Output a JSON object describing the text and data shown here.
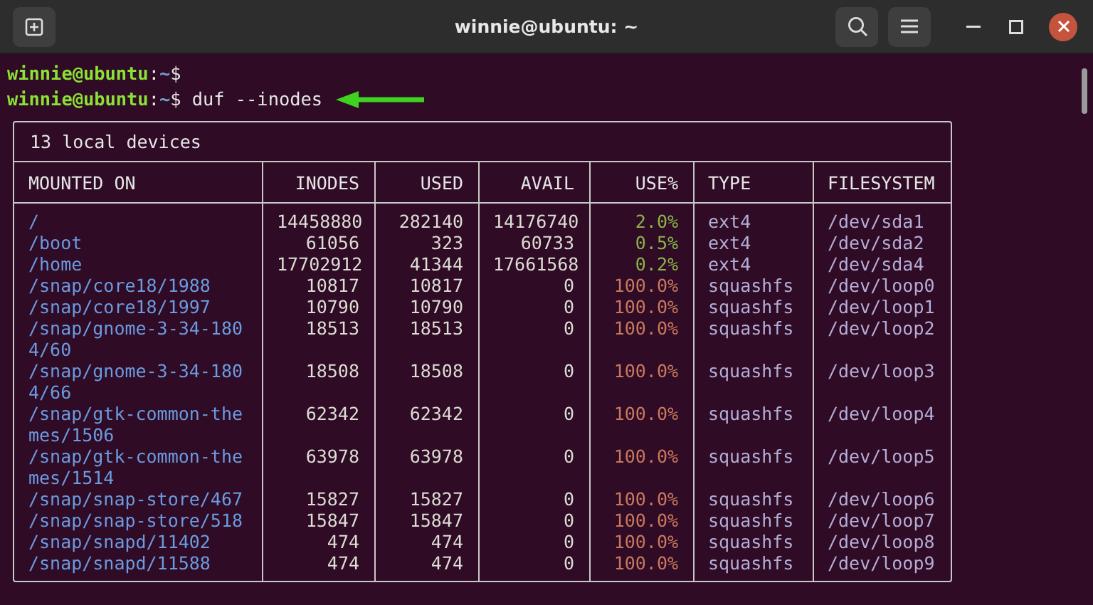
{
  "window": {
    "title": "winnie@ubuntu: ~"
  },
  "terminal_lines": [
    {
      "user": "winnie@ubuntu",
      "separator": ":",
      "path": "~",
      "symbol": "$"
    },
    {
      "user": "winnie@ubuntu",
      "separator": ":",
      "path": "~",
      "symbol": "$",
      "command": "duf --inodes"
    }
  ],
  "table": {
    "title": "13 local devices",
    "columns": [
      "MOUNTED ON",
      "INODES",
      "USED",
      "AVAIL",
      "USE%",
      "TYPE",
      "FILESYSTEM"
    ],
    "rows": [
      {
        "mounted_on": "/",
        "inodes": "14458880",
        "used": "282140",
        "avail": "14176740",
        "use_pct": "2.0%",
        "color": "#8ab446",
        "type": "ext4",
        "filesystem": "/dev/sda1"
      },
      {
        "mounted_on": "/boot",
        "inodes": "61056",
        "used": "323",
        "avail": "60733",
        "use_pct": "0.5%",
        "color": "#8ab446",
        "type": "ext4",
        "filesystem": "/dev/sda2"
      },
      {
        "mounted_on": "/home",
        "inodes": "17702912",
        "used": "41344",
        "avail": "17661568",
        "use_pct": "0.2%",
        "color": "#8ab446",
        "type": "ext4",
        "filesystem": "/dev/sda4"
      },
      {
        "mounted_on": "/snap/core18/1988",
        "inodes": "10817",
        "used": "10817",
        "avail": "0",
        "use_pct": "100.0%",
        "color": "#c8785c",
        "type": "squashfs",
        "filesystem": "/dev/loop0"
      },
      {
        "mounted_on": "/snap/core18/1997",
        "inodes": "10790",
        "used": "10790",
        "avail": "0",
        "use_pct": "100.0%",
        "color": "#c8785c",
        "type": "squashfs",
        "filesystem": "/dev/loop1"
      },
      {
        "mounted_on": "/snap/gnome-3-34-1804/60",
        "inodes": "18513",
        "used": "18513",
        "avail": "0",
        "use_pct": "100.0%",
        "color": "#c8785c",
        "type": "squashfs",
        "filesystem": "/dev/loop2"
      },
      {
        "mounted_on": "/snap/gnome-3-34-1804/66",
        "inodes": "18508",
        "used": "18508",
        "avail": "0",
        "use_pct": "100.0%",
        "color": "#c8785c",
        "type": "squashfs",
        "filesystem": "/dev/loop3"
      },
      {
        "mounted_on": "/snap/gtk-common-themes/1506",
        "inodes": "62342",
        "used": "62342",
        "avail": "0",
        "use_pct": "100.0%",
        "color": "#c8785c",
        "type": "squashfs",
        "filesystem": "/dev/loop4"
      },
      {
        "mounted_on": "/snap/gtk-common-themes/1514",
        "inodes": "63978",
        "used": "63978",
        "avail": "0",
        "use_pct": "100.0%",
        "color": "#c8785c",
        "type": "squashfs",
        "filesystem": "/dev/loop5"
      },
      {
        "mounted_on": "/snap/snap-store/467",
        "inodes": "15827",
        "used": "15827",
        "avail": "0",
        "use_pct": "100.0%",
        "color": "#c8785c",
        "type": "squashfs",
        "filesystem": "/dev/loop6"
      },
      {
        "mounted_on": "/snap/snap-store/518",
        "inodes": "15847",
        "used": "15847",
        "avail": "0",
        "use_pct": "100.0%",
        "color": "#c8785c",
        "type": "squashfs",
        "filesystem": "/dev/loop7"
      },
      {
        "mounted_on": "/snap/snapd/11402",
        "inodes": "474",
        "used": "474",
        "avail": "0",
        "use_pct": "100.0%",
        "color": "#c8785c",
        "type": "squashfs",
        "filesystem": "/dev/loop8"
      },
      {
        "mounted_on": "/snap/snapd/11588",
        "inodes": "474",
        "used": "474",
        "avail": "0",
        "use_pct": "100.0%",
        "color": "#c8785c",
        "type": "squashfs",
        "filesystem": "/dev/loop9"
      }
    ]
  }
}
